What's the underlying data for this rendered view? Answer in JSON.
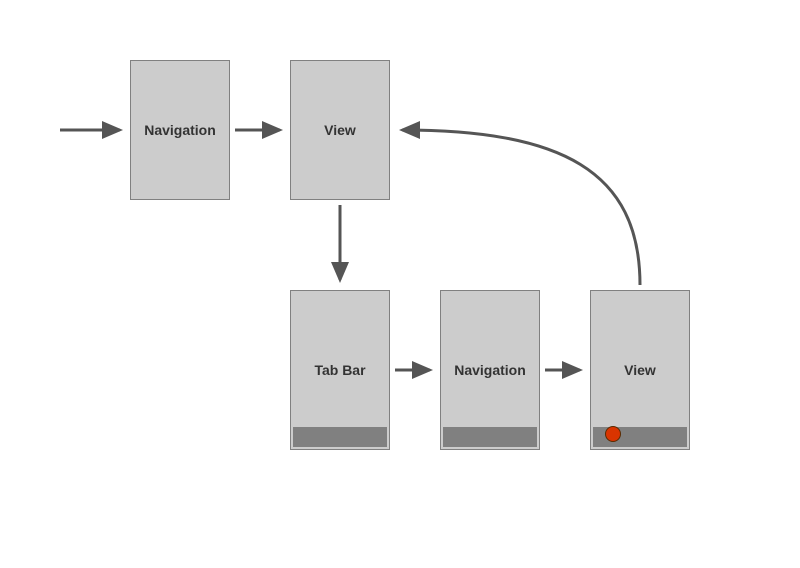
{
  "diagram": {
    "nodes": {
      "navigation1": {
        "label": "Navigation"
      },
      "view1": {
        "label": "View"
      },
      "tabbar": {
        "label": "Tab Bar"
      },
      "navigation2": {
        "label": "Navigation"
      },
      "view2": {
        "label": "View"
      }
    },
    "edges": [
      {
        "from": "start",
        "to": "navigation1"
      },
      {
        "from": "navigation1",
        "to": "view1"
      },
      {
        "from": "view1",
        "to": "tabbar"
      },
      {
        "from": "tabbar",
        "to": "navigation2"
      },
      {
        "from": "navigation2",
        "to": "view2"
      },
      {
        "from": "view2",
        "to": "view1"
      }
    ],
    "style": {
      "node_fill": "#cccccc",
      "node_stroke": "#808080",
      "arrow_color": "#555555",
      "tabbar_fill": "#808080",
      "accent_dot": "#d93400"
    }
  }
}
